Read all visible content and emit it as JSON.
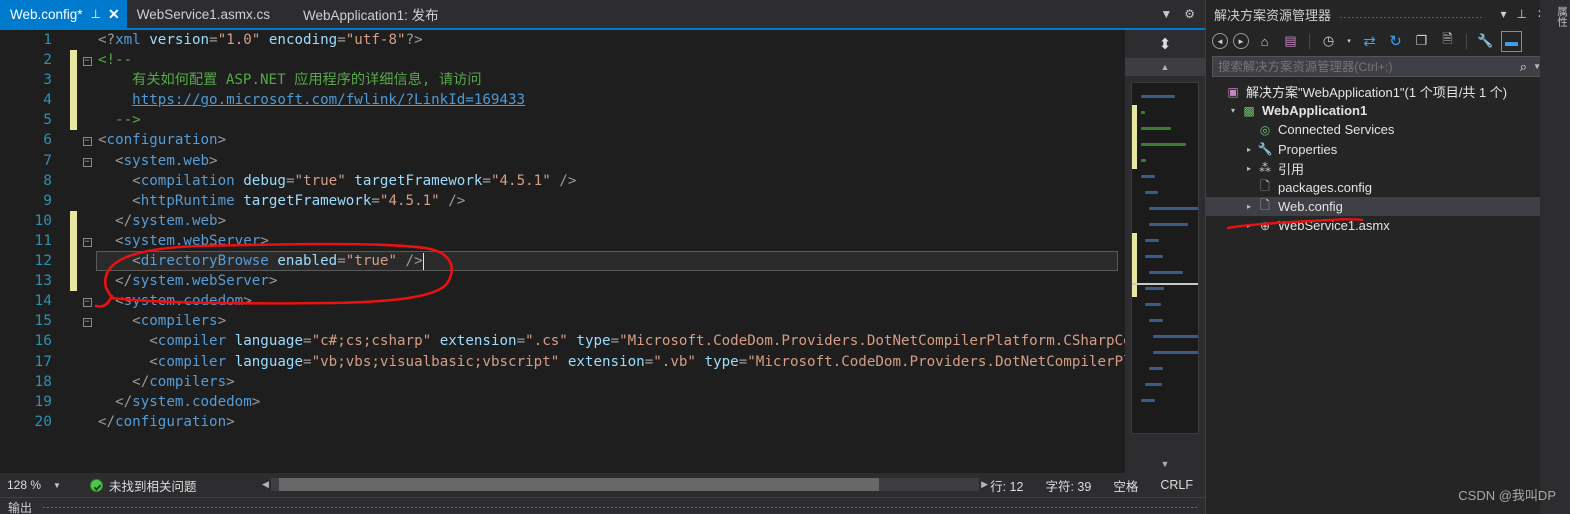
{
  "window": {
    "watermark": "CSDN @我叫DP"
  },
  "tabs": {
    "items": [
      {
        "label": "Web.config*",
        "active": true,
        "pin_icon": "pin-icon",
        "close_icon": "close-icon"
      },
      {
        "label": "WebService1.asmx.cs",
        "active": false
      },
      {
        "label": "WebApplication1: 发布",
        "active": false
      }
    ],
    "right_controls": [
      {
        "name": "tab-dropdown-icon",
        "glyph": "▼"
      },
      {
        "name": "gear-icon",
        "glyph": "⚙"
      }
    ]
  },
  "editor": {
    "lines": [
      {
        "n": "1",
        "change": false,
        "fold": "",
        "indent": 0,
        "tokens": [
          {
            "t": "punct",
            "v": "<?"
          },
          {
            "t": "tag",
            "v": "xml"
          },
          {
            "t": "plain",
            "v": " "
          },
          {
            "t": "attr",
            "v": "version"
          },
          {
            "t": "punct",
            "v": "="
          },
          {
            "t": "str",
            "v": "\"1.0\""
          },
          {
            "t": "plain",
            "v": " "
          },
          {
            "t": "attr",
            "v": "encoding"
          },
          {
            "t": "punct",
            "v": "="
          },
          {
            "t": "str",
            "v": "\"utf-8\""
          },
          {
            "t": "punct",
            "v": "?>"
          }
        ]
      },
      {
        "n": "2",
        "change": true,
        "fold": "minus",
        "indent": 0,
        "tokens": [
          {
            "t": "cmt",
            "v": "<!--"
          }
        ]
      },
      {
        "n": "3",
        "change": true,
        "fold": "",
        "indent": 0,
        "tokens": [
          {
            "t": "cmt",
            "v": "    有关如何配置 ASP.NET 应用程序的详细信息, 请访问"
          }
        ]
      },
      {
        "n": "4",
        "change": true,
        "fold": "",
        "indent": 0,
        "tokens": [
          {
            "t": "plain",
            "v": "    "
          },
          {
            "t": "link",
            "v": "https://go.microsoft.com/fwlink/?LinkId=169433"
          }
        ]
      },
      {
        "n": "5",
        "change": true,
        "fold": "",
        "indent": 0,
        "tokens": [
          {
            "t": "cmt",
            "v": "  -->"
          }
        ]
      },
      {
        "n": "6",
        "change": false,
        "fold": "minus",
        "indent": 0,
        "tokens": [
          {
            "t": "punct",
            "v": "<"
          },
          {
            "t": "tag",
            "v": "configuration"
          },
          {
            "t": "punct",
            "v": ">"
          }
        ]
      },
      {
        "n": "7",
        "change": false,
        "fold": "minus",
        "indent": 1,
        "tokens": [
          {
            "t": "punct",
            "v": "  <"
          },
          {
            "t": "tag",
            "v": "system.web"
          },
          {
            "t": "punct",
            "v": ">"
          }
        ]
      },
      {
        "n": "8",
        "change": false,
        "fold": "",
        "indent": 2,
        "tokens": [
          {
            "t": "punct",
            "v": "    <"
          },
          {
            "t": "tag",
            "v": "compilation"
          },
          {
            "t": "plain",
            "v": " "
          },
          {
            "t": "attr",
            "v": "debug"
          },
          {
            "t": "punct",
            "v": "="
          },
          {
            "t": "str",
            "v": "\"true\""
          },
          {
            "t": "plain",
            "v": " "
          },
          {
            "t": "attr",
            "v": "targetFramework"
          },
          {
            "t": "punct",
            "v": "="
          },
          {
            "t": "str",
            "v": "\"4.5.1\""
          },
          {
            "t": "punct",
            "v": " />"
          }
        ]
      },
      {
        "n": "9",
        "change": false,
        "fold": "",
        "indent": 2,
        "tokens": [
          {
            "t": "punct",
            "v": "    <"
          },
          {
            "t": "tag",
            "v": "httpRuntime"
          },
          {
            "t": "plain",
            "v": " "
          },
          {
            "t": "attr",
            "v": "targetFramework"
          },
          {
            "t": "punct",
            "v": "="
          },
          {
            "t": "str",
            "v": "\"4.5.1\""
          },
          {
            "t": "punct",
            "v": " />"
          }
        ]
      },
      {
        "n": "10",
        "change": true,
        "fold": "",
        "indent": 1,
        "tokens": [
          {
            "t": "punct",
            "v": "  </"
          },
          {
            "t": "tag",
            "v": "system.web"
          },
          {
            "t": "punct",
            "v": ">"
          }
        ]
      },
      {
        "n": "11",
        "change": true,
        "fold": "minus",
        "indent": 1,
        "tokens": [
          {
            "t": "punct",
            "v": "  <"
          },
          {
            "t": "tag",
            "v": "system.webServer"
          },
          {
            "t": "punct",
            "v": ">"
          }
        ]
      },
      {
        "n": "12",
        "change": true,
        "fold": "",
        "indent": 2,
        "current": true,
        "tokens": [
          {
            "t": "punct",
            "v": "    <"
          },
          {
            "t": "tag",
            "v": "directoryBrowse"
          },
          {
            "t": "plain",
            "v": " "
          },
          {
            "t": "attr",
            "v": "enabled"
          },
          {
            "t": "punct",
            "v": "="
          },
          {
            "t": "str",
            "v": "\"true\""
          },
          {
            "t": "punct",
            "v": " />"
          }
        ]
      },
      {
        "n": "13",
        "change": true,
        "fold": "",
        "indent": 1,
        "tokens": [
          {
            "t": "punct",
            "v": "  </"
          },
          {
            "t": "tag",
            "v": "system.webServer"
          },
          {
            "t": "punct",
            "v": ">"
          }
        ]
      },
      {
        "n": "14",
        "change": false,
        "fold": "minus",
        "indent": 1,
        "tokens": [
          {
            "t": "punct",
            "v": "  <"
          },
          {
            "t": "tag",
            "v": "system.codedom"
          },
          {
            "t": "punct",
            "v": ">"
          }
        ]
      },
      {
        "n": "15",
        "change": false,
        "fold": "minus",
        "indent": 2,
        "tokens": [
          {
            "t": "punct",
            "v": "    <"
          },
          {
            "t": "tag",
            "v": "compilers"
          },
          {
            "t": "punct",
            "v": ">"
          }
        ]
      },
      {
        "n": "16",
        "change": false,
        "fold": "",
        "indent": 3,
        "tokens": [
          {
            "t": "punct",
            "v": "      <"
          },
          {
            "t": "tag",
            "v": "compiler"
          },
          {
            "t": "plain",
            "v": " "
          },
          {
            "t": "attr",
            "v": "language"
          },
          {
            "t": "punct",
            "v": "="
          },
          {
            "t": "str",
            "v": "\"c#;cs;csharp\""
          },
          {
            "t": "plain",
            "v": " "
          },
          {
            "t": "attr",
            "v": "extension"
          },
          {
            "t": "punct",
            "v": "="
          },
          {
            "t": "str",
            "v": "\".cs\""
          },
          {
            "t": "plain",
            "v": " "
          },
          {
            "t": "attr",
            "v": "type"
          },
          {
            "t": "punct",
            "v": "="
          },
          {
            "t": "str",
            "v": "\"Microsoft.CodeDom.Providers.DotNetCompilerPlatform.CSharpCodeP"
          }
        ]
      },
      {
        "n": "17",
        "change": false,
        "fold": "",
        "indent": 3,
        "tokens": [
          {
            "t": "punct",
            "v": "      <"
          },
          {
            "t": "tag",
            "v": "compiler"
          },
          {
            "t": "plain",
            "v": " "
          },
          {
            "t": "attr",
            "v": "language"
          },
          {
            "t": "punct",
            "v": "="
          },
          {
            "t": "str",
            "v": "\"vb;vbs;visualbasic;vbscript\""
          },
          {
            "t": "plain",
            "v": " "
          },
          {
            "t": "attr",
            "v": "extension"
          },
          {
            "t": "punct",
            "v": "="
          },
          {
            "t": "str",
            "v": "\".vb\""
          },
          {
            "t": "plain",
            "v": " "
          },
          {
            "t": "attr",
            "v": "type"
          },
          {
            "t": "punct",
            "v": "="
          },
          {
            "t": "str",
            "v": "\"Microsoft.CodeDom.Providers.DotNetCompilerPlatf"
          }
        ]
      },
      {
        "n": "18",
        "change": false,
        "fold": "",
        "indent": 2,
        "tokens": [
          {
            "t": "punct",
            "v": "    </"
          },
          {
            "t": "tag",
            "v": "compilers"
          },
          {
            "t": "punct",
            "v": ">"
          }
        ]
      },
      {
        "n": "19",
        "change": false,
        "fold": "",
        "indent": 1,
        "tokens": [
          {
            "t": "punct",
            "v": "  </"
          },
          {
            "t": "tag",
            "v": "system.codedom"
          },
          {
            "t": "punct",
            "v": ">"
          }
        ]
      },
      {
        "n": "20",
        "change": false,
        "fold": "",
        "indent": 0,
        "tokens": [
          {
            "t": "punct",
            "v": "</"
          },
          {
            "t": "tag",
            "v": "configuration"
          },
          {
            "t": "punct",
            "v": ">"
          }
        ]
      }
    ]
  },
  "minimap": {
    "splitter_icon": "split-editor-icon",
    "scroll_up_icon": "chevron-up-icon",
    "scroll_down_icon": "chevron-down-icon"
  },
  "statusbar": {
    "zoom": "128 %",
    "zoom_caret_icon": "chevron-down-icon",
    "issue_icon": "check-circle-icon",
    "issue_text": "未找到相关问题",
    "scroll_left_icon": "triangle-left-icon",
    "scroll_right_icon": "triangle-right-icon",
    "line": "行: 12",
    "column": "字符: 39",
    "indent_mode": "空格",
    "line_endings": "CRLF"
  },
  "output_panel": {
    "label": "输出"
  },
  "solution_explorer": {
    "title": "解决方案资源管理器",
    "header_buttons": [
      {
        "name": "panel-dropdown-icon",
        "glyph": "▾"
      },
      {
        "name": "pin-icon",
        "glyph": "⊥"
      },
      {
        "name": "close-icon",
        "glyph": "✕"
      }
    ],
    "toolbar": [
      {
        "name": "back-icon",
        "glyph": "◄",
        "style": "circle"
      },
      {
        "name": "forward-icon",
        "glyph": "►",
        "style": "circle"
      },
      {
        "name": "home-icon",
        "glyph": "⌂",
        "style": "plain"
      },
      {
        "name": "properties-window-icon",
        "glyph": "▤",
        "style": "purple"
      },
      {
        "name": "pending-changes-icon",
        "glyph": "◷",
        "style": "plain"
      },
      {
        "name": "pending-changes-dropdown-icon",
        "glyph": "▾",
        "style": "caret"
      },
      {
        "name": "sync-with-active-document-icon",
        "glyph": "⇄",
        "style": "blue"
      },
      {
        "name": "refresh-icon",
        "glyph": "↻",
        "style": "blue"
      },
      {
        "name": "collapse-all-icon",
        "glyph": "❐",
        "style": "plain"
      },
      {
        "name": "show-all-files-icon",
        "glyph": "🗎",
        "style": "plain"
      },
      {
        "name": "properties-icon",
        "glyph": "🔧",
        "style": "plain"
      },
      {
        "name": "preview-selected-items-icon",
        "glyph": "▬",
        "style": "selected"
      }
    ],
    "search": {
      "placeholder": "搜索解决方案资源管理器(Ctrl+;)",
      "value": "",
      "search_icon": "magnifier-icon",
      "dropdown_icon": "chevron-down-icon"
    },
    "tree": [
      {
        "label": "解决方案\"WebApplication1\"(1 个项目/共 1 个)",
        "depth": 0,
        "expander": "",
        "icon": "solution-icon",
        "icon_glyph": "▣",
        "icon_color": "#c586c0",
        "bold": false,
        "selected": false
      },
      {
        "label": "WebApplication1",
        "depth": 1,
        "expander": "▾",
        "icon": "web-project-icon",
        "icon_glyph": "▩",
        "icon_color": "#6fbf73",
        "bold": true,
        "selected": false
      },
      {
        "label": "Connected Services",
        "depth": 2,
        "expander": "",
        "icon": "connected-services-icon",
        "icon_glyph": "◎",
        "icon_color": "#6fbf73",
        "bold": false,
        "selected": false
      },
      {
        "label": "Properties",
        "depth": 2,
        "expander": "▸",
        "icon": "properties-folder-icon",
        "icon_glyph": "🔧",
        "icon_color": "#c8c8c8",
        "bold": false,
        "selected": false
      },
      {
        "label": "引用",
        "depth": 2,
        "expander": "▸",
        "icon": "references-icon",
        "icon_glyph": "⁂",
        "icon_color": "#c8c8c8",
        "bold": false,
        "selected": false
      },
      {
        "label": "packages.config",
        "depth": 2,
        "expander": "",
        "icon": "config-file-icon",
        "icon_glyph": "🗋",
        "icon_color": "#c8c8c8",
        "bold": false,
        "selected": false
      },
      {
        "label": "Web.config",
        "depth": 2,
        "expander": "▸",
        "icon": "config-file-icon",
        "icon_glyph": "🗋",
        "icon_color": "#c8c8c8",
        "bold": false,
        "selected": true
      },
      {
        "label": "WebService1.asmx",
        "depth": 2,
        "expander": "▸",
        "icon": "asmx-file-icon",
        "icon_glyph": "⊕",
        "icon_color": "#c8c8c8",
        "bold": false,
        "selected": false
      }
    ]
  },
  "right_strip": {
    "label": "属性"
  },
  "colors": {
    "accent": "#007acc",
    "editor_bg": "#1e1e1e",
    "chrome_bg": "#2d2d30",
    "annotation": "#e81212",
    "change_bar": "#e6e6a0"
  }
}
